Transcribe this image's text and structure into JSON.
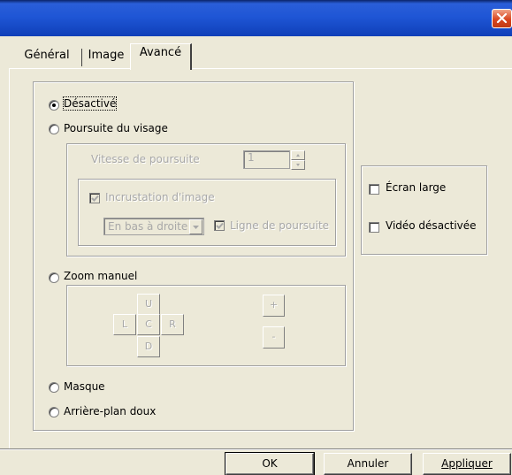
{
  "window": {
    "title": ""
  },
  "tabs": [
    {
      "label": "Général",
      "active": false
    },
    {
      "label": "Image",
      "active": false
    },
    {
      "label": "Avancé",
      "active": true
    }
  ],
  "mode_options": {
    "desactive": {
      "label": "Désactivé",
      "checked": true
    },
    "poursuite": {
      "label": "Poursuite du visage",
      "checked": false
    },
    "zoom": {
      "label": "Zoom manuel",
      "checked": false
    },
    "masque": {
      "label": "Masque",
      "checked": false
    },
    "arriere_plan": {
      "label": "Arrière-plan doux",
      "checked": false
    }
  },
  "tracking": {
    "speed_label": "Vitesse de poursuite",
    "speed_value": "1",
    "overlay": {
      "label": "Incrustation d'image",
      "checked": true
    },
    "position": {
      "selected": "En bas à droite"
    },
    "tracking_line": {
      "label": "Ligne de poursuite",
      "checked": true
    }
  },
  "zoom_pad": {
    "up": "U",
    "left": "L",
    "center": "C",
    "right": "R",
    "down": "D",
    "plus": "+",
    "minus": "-"
  },
  "display_options": {
    "wide_screen": {
      "label": "Écran large",
      "checked": false
    },
    "video_off": {
      "label": "Vidéo désactivée",
      "checked": false
    }
  },
  "buttons": {
    "ok": "OK",
    "cancel": "Annuler",
    "apply": "Appliquer"
  },
  "colors": {
    "titlebar": "#1f56d6",
    "close": "#d9451f",
    "face": "#ece9d8",
    "disabled_text": "#a8a8a8"
  }
}
